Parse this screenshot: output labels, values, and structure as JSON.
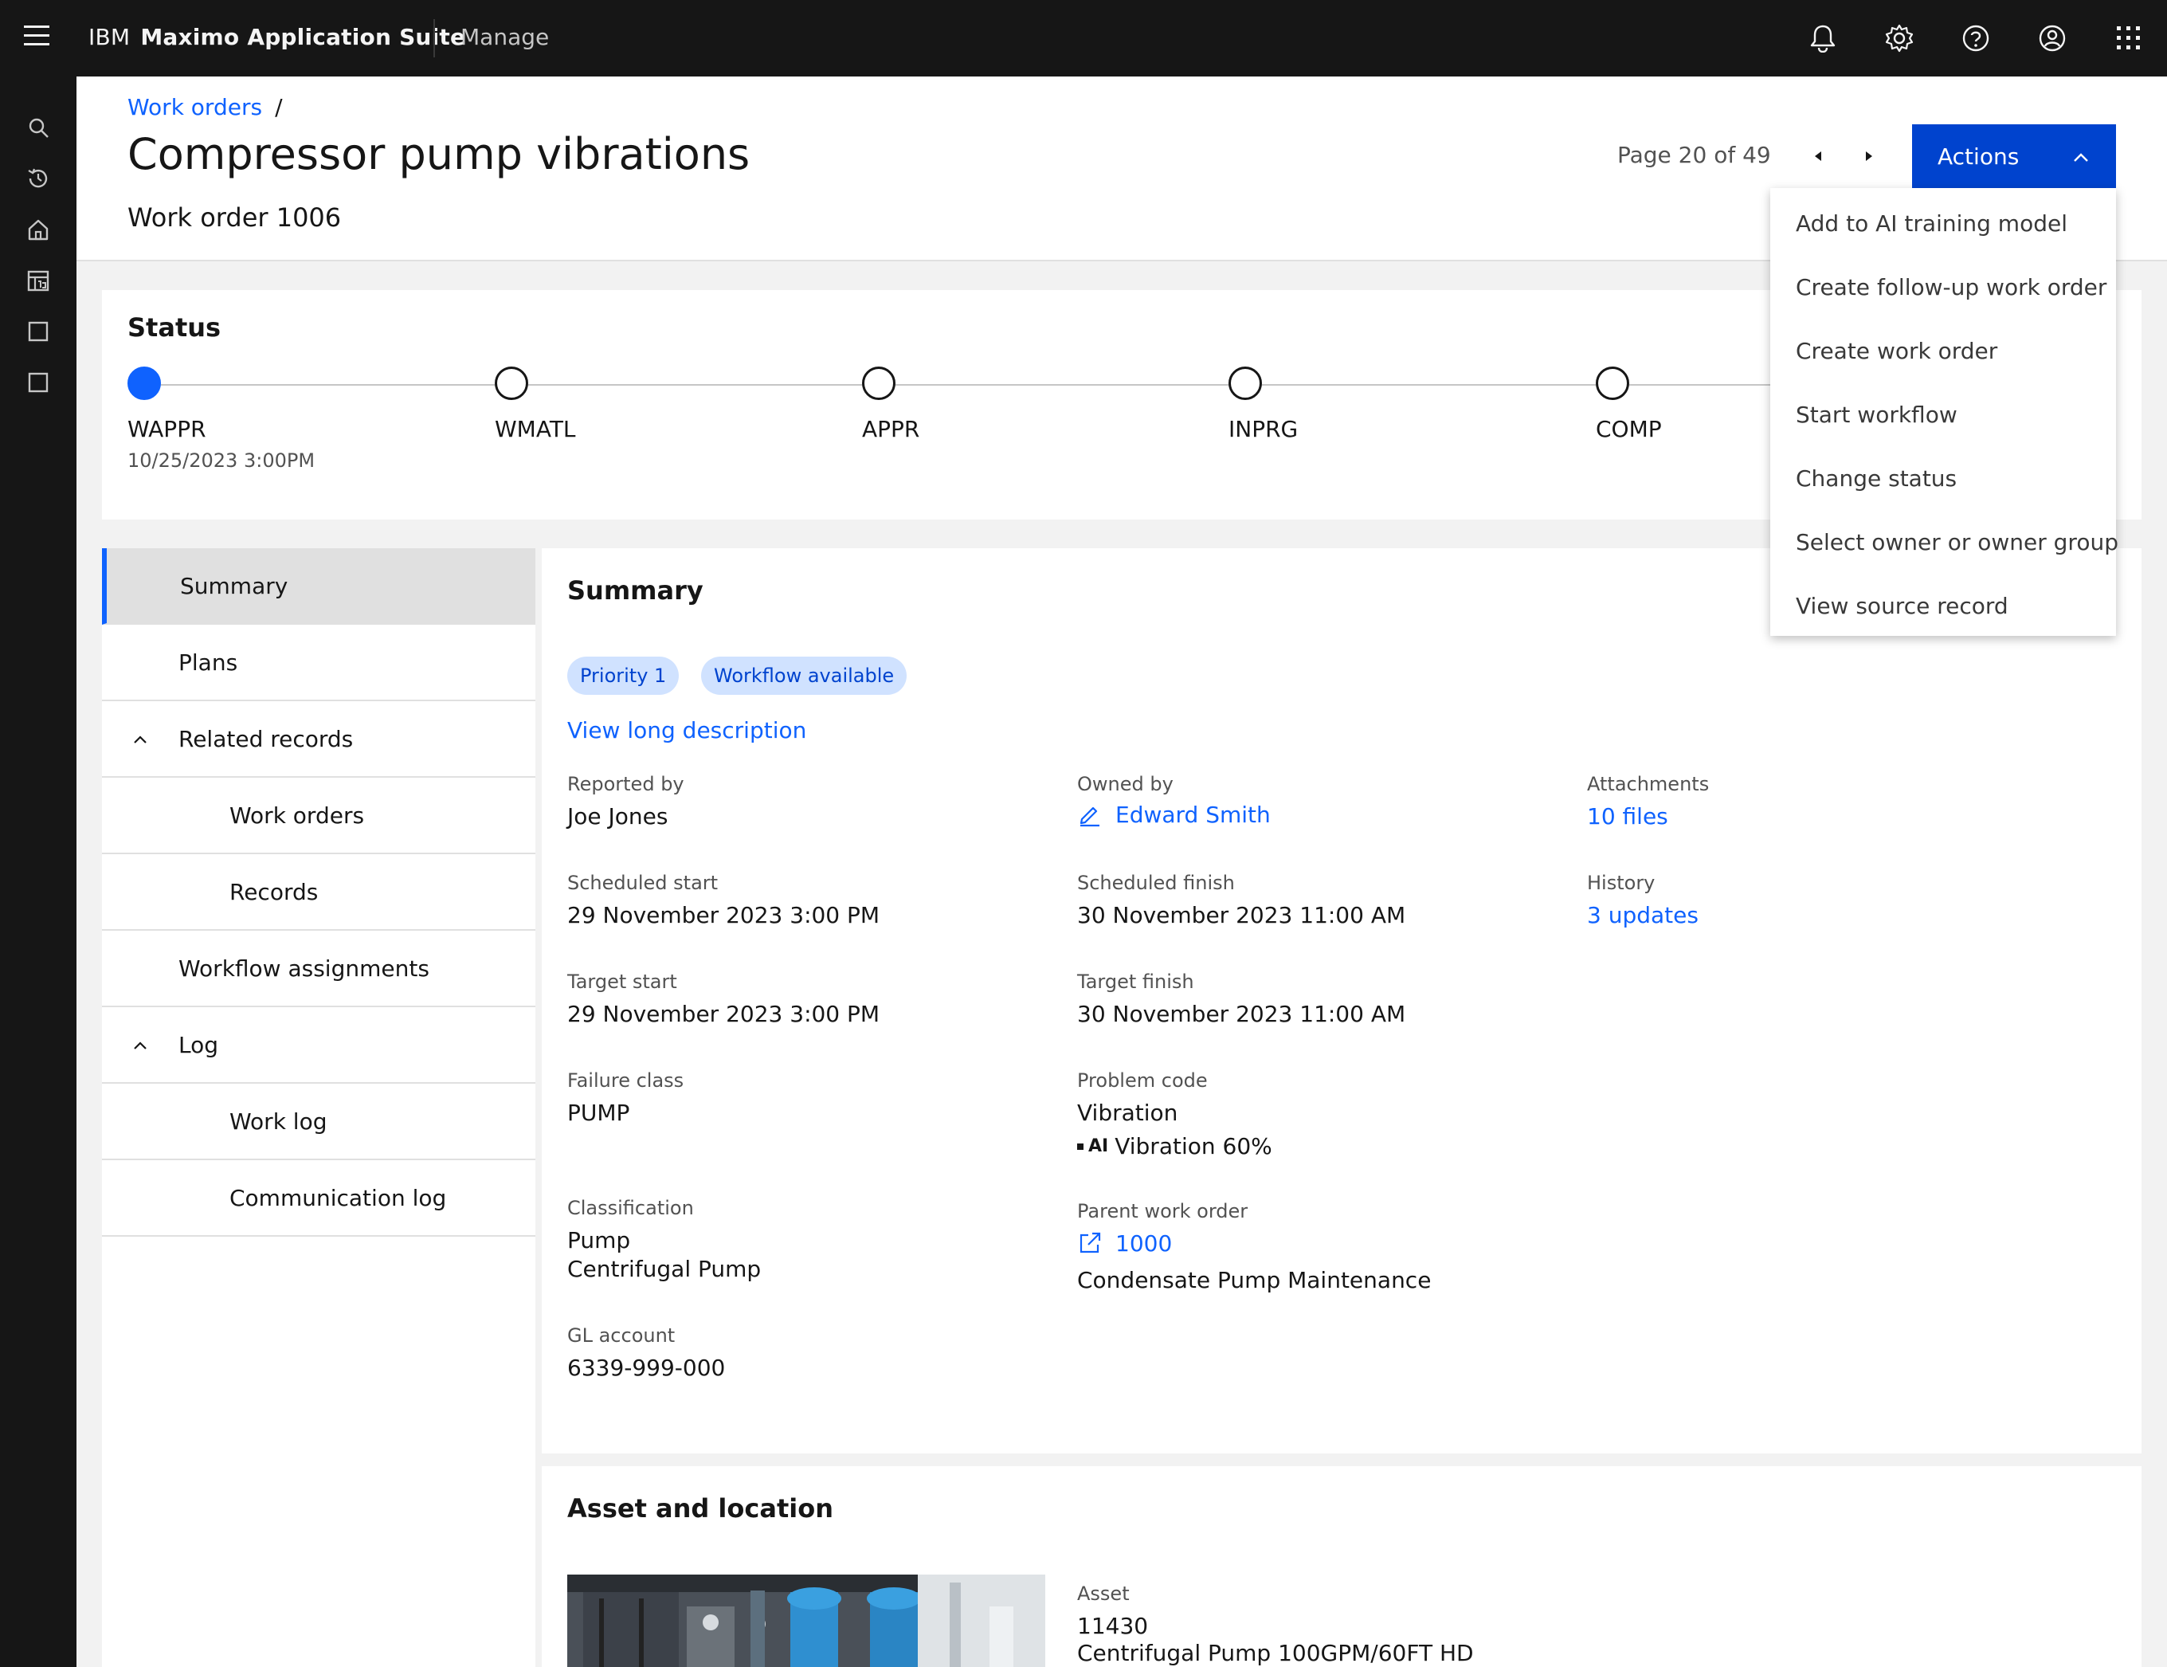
{
  "header": {
    "brand_prefix": "IBM",
    "brand_name": "Maximo Application Suite",
    "app_name": "Manage",
    "icons": [
      "notification-icon",
      "settings-icon",
      "help-icon",
      "user-icon",
      "app-switcher-icon"
    ]
  },
  "rail": {
    "icons": [
      "search-icon",
      "recent-icon",
      "home-icon",
      "calendar-icon",
      "square-icon",
      "square-icon"
    ]
  },
  "breadcrumb": {
    "link": "Work orders",
    "separator": "/"
  },
  "page": {
    "title": "Compressor pump vibrations",
    "subtitle": "Work order 1006",
    "pager_text": "Page 20 of 49",
    "actions_label": "Actions"
  },
  "actions_menu": {
    "items": [
      "Add to AI training model",
      "Create follow-up work order",
      "Create work order",
      "Start workflow",
      "Change status",
      "Select owner or owner group",
      "View source record"
    ]
  },
  "status": {
    "title": "Status",
    "steps": [
      {
        "label": "WAPPR",
        "date": "10/25/2023 3:00PM",
        "active": true
      },
      {
        "label": "WMATL",
        "date": "",
        "active": false
      },
      {
        "label": "APPR",
        "date": "",
        "active": false
      },
      {
        "label": "INPRG",
        "date": "",
        "active": false
      },
      {
        "label": "COMP",
        "date": "",
        "active": false
      }
    ]
  },
  "side_nav": {
    "items": [
      {
        "label": "Summary",
        "selected": true
      },
      {
        "label": "Plans"
      },
      {
        "label": "Related records",
        "expandable": true
      },
      {
        "label": "Work orders",
        "child": true
      },
      {
        "label": "Records",
        "child": true
      },
      {
        "label": "Workflow assignments"
      },
      {
        "label": "Log",
        "expandable": true
      },
      {
        "label": "Work log",
        "child": true
      },
      {
        "label": "Communication log",
        "child": true
      }
    ]
  },
  "summary": {
    "title": "Summary",
    "tags": [
      "Priority 1",
      "Workflow available"
    ],
    "long_description_link": "View long description",
    "reported_by": {
      "label": "Reported by",
      "value": "Joe Jones"
    },
    "owned_by": {
      "label": "Owned by",
      "value": "Edward Smith"
    },
    "attachments": {
      "label": "Attachments",
      "value": "10 files"
    },
    "scheduled_start": {
      "label": "Scheduled start",
      "value": "29 November 2023 3:00 PM"
    },
    "scheduled_finish": {
      "label": "Scheduled finish",
      "value": "30 November 2023 11:00 AM"
    },
    "history": {
      "label": "History",
      "value": "3 updates"
    },
    "target_start": {
      "label": "Target start",
      "value": "29 November 2023 3:00 PM"
    },
    "target_finish": {
      "label": "Target finish",
      "value": "30 November 2023 11:00 AM"
    },
    "failure_class": {
      "label": "Failure class",
      "value": "PUMP"
    },
    "problem_code": {
      "label": "Problem code",
      "value": "Vibration",
      "ai_badge": "AI",
      "ai_value": "Vibration 60%"
    },
    "classification": {
      "label": "Classification",
      "value_line1": "Pump",
      "value_line2": "Centrifugal Pump"
    },
    "parent_work_order": {
      "label": "Parent work order",
      "value": "1000",
      "description": "Condensate Pump Maintenance"
    },
    "gl_account": {
      "label": "GL account",
      "value": "6339-999-000"
    }
  },
  "asset_location": {
    "title": "Asset and location",
    "asset_label": "Asset",
    "asset_id": "11430",
    "asset_description": "Centrifugal Pump 100GPM/60FT HD"
  }
}
